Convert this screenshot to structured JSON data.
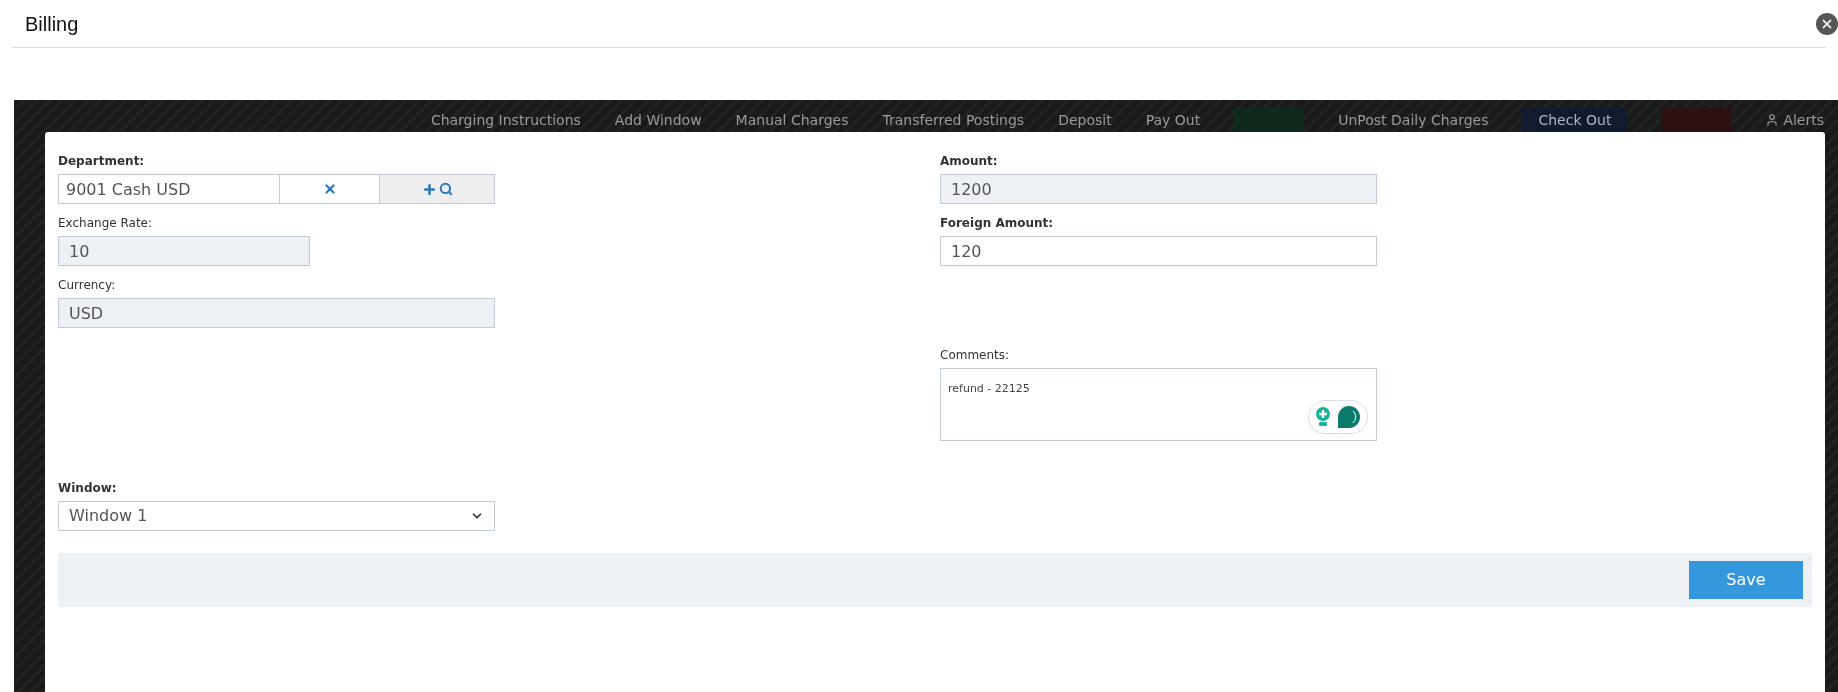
{
  "dialog": {
    "title": "Billing"
  },
  "background_nav": {
    "items": [
      {
        "kind": "link",
        "label": "Charging Instructions"
      },
      {
        "kind": "link",
        "label": "Add Window"
      },
      {
        "kind": "link",
        "label": "Manual Charges"
      },
      {
        "kind": "link",
        "label": "Transferred Postings"
      },
      {
        "kind": "link",
        "label": "Deposit"
      },
      {
        "kind": "link",
        "label": "Pay Out"
      },
      {
        "kind": "button",
        "color": "#0f2a1d"
      },
      {
        "kind": "link",
        "label": "UnPost Daily Charges"
      },
      {
        "kind": "button",
        "label": "Check Out",
        "color": "#111b30"
      },
      {
        "kind": "button",
        "color": "#2c1111"
      },
      {
        "kind": "alert",
        "label": "Alerts"
      }
    ]
  },
  "form": {
    "department": {
      "label": "Department:",
      "value": "9001 Cash USD"
    },
    "exchange_rate": {
      "label": "Exchange Rate:",
      "value": "10",
      "readonly": true
    },
    "currency": {
      "label": "Currency:",
      "value": "USD",
      "readonly": true
    },
    "amount": {
      "label": "Amount:",
      "value": "1200",
      "readonly": true
    },
    "foreign_amount": {
      "label": "Foreign Amount:",
      "value": "120",
      "readonly": false
    },
    "comments": {
      "label": "Comments:",
      "value": "refund - 22125"
    },
    "window": {
      "label": "Window:",
      "value": "Window 1"
    }
  },
  "save_button": "Save"
}
